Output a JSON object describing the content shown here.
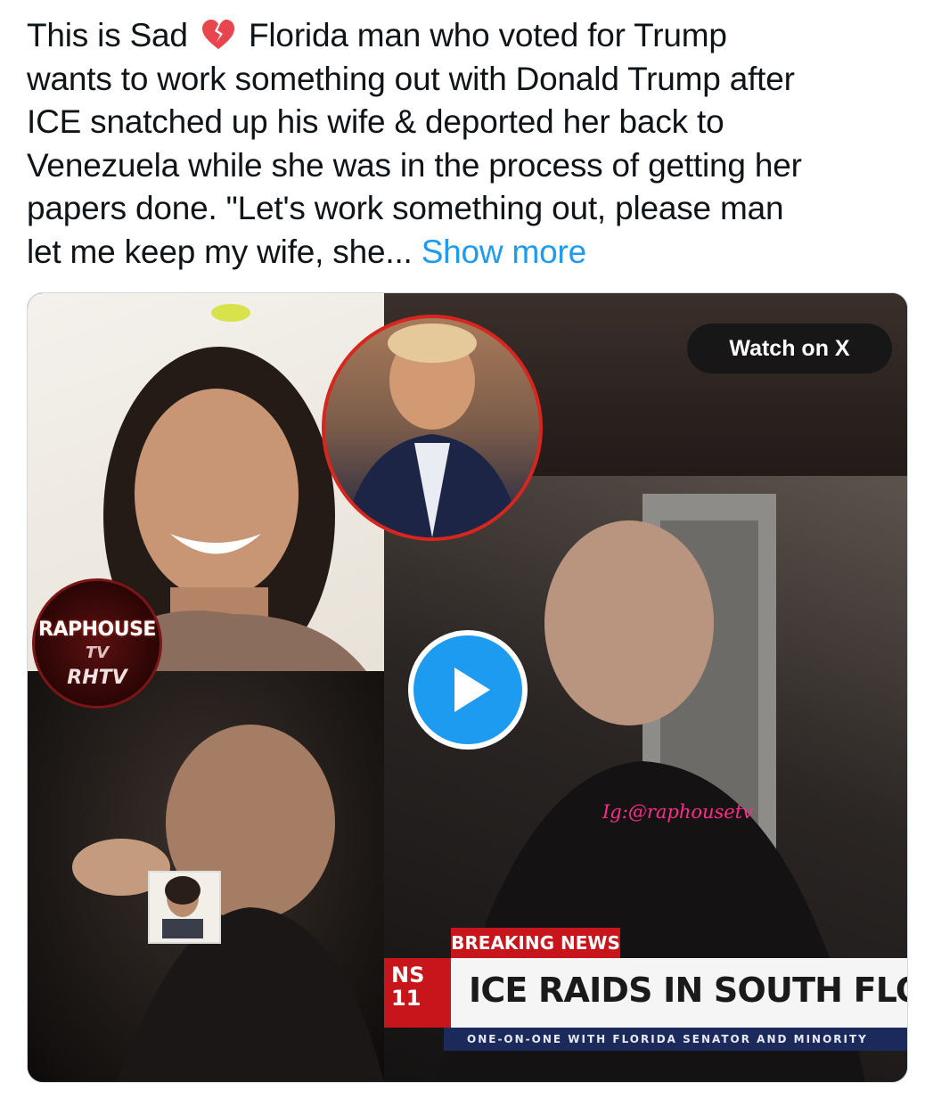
{
  "post": {
    "lines": [
      [
        "This is Sad",
        "Florida man who voted for Trump"
      ],
      "wants to work something out with Donald Trump after",
      "ICE snatched up his wife & deported her back to",
      "Venezuela while she was in the process of getting her",
      "papers done. \"Let's work something out, please man",
      "let me keep my wife, she..."
    ],
    "line1_before_emoji": "This is Sad",
    "line1_after_emoji": "Florida man who voted for Trump",
    "line2": "wants to work something out with Donald Trump after",
    "line3": "ICE snatched up his wife & deported her back to",
    "line4": "Venezuela while she was in the process of getting her",
    "line5": "papers done. \"Let's work something out, please man",
    "line6": "let me keep my wife, she...",
    "show_more": "Show more",
    "emoji_name": "broken-heart-icon"
  },
  "media": {
    "watch_label": "Watch on X",
    "play_icon": "play-icon",
    "logo": {
      "main": "RAPHOUSE",
      "sub": "TV",
      "sub2": "RHTV"
    },
    "watermark": "Ig:@raphousetv",
    "news": {
      "tag": "BREAKING NEWS",
      "stub": "NS 11",
      "headline": "ICE RAIDS IN SOUTH FLORID",
      "subline": "ONE-ON-ONE WITH FLORIDA SENATOR AND MINORITY"
    }
  },
  "colors": {
    "text": "#0f1419",
    "link": "#1d9bf0",
    "play": "#1d9bf0",
    "breaking_red": "#c8151b",
    "ticker_navy": "#1b2a5a"
  }
}
